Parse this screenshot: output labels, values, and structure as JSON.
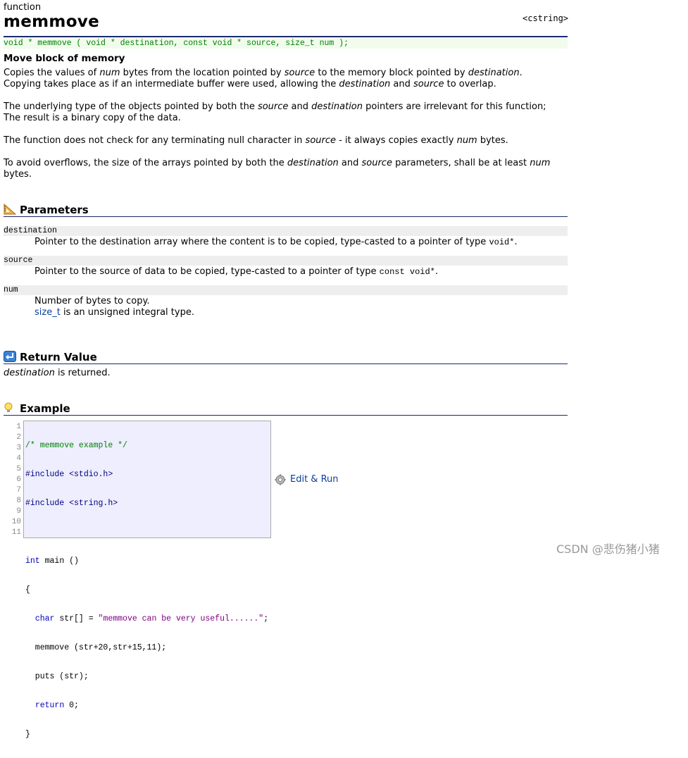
{
  "page": {
    "kind": "function",
    "title": "memmove",
    "header": "<cstring>",
    "prototype": "void * memmove ( void * destination, const void * source, size_t num );",
    "short_description": "Move block of memory"
  },
  "description": {
    "p1": {
      "a": "Copies the values of ",
      "b": "num",
      "c": " bytes from the location pointed by ",
      "d": "source",
      "e": " to the memory block pointed by ",
      "f": "destination",
      "g": ".",
      "h": "Copying takes place as if an intermediate buffer were used, allowing the ",
      "i": "destination",
      "j": " and ",
      "k": "source",
      "l": " to overlap."
    },
    "p2": {
      "a": "The underlying type of the objects pointed by both the ",
      "b": "source",
      "c": " and ",
      "d": "destination",
      "e": " pointers are irrelevant for this function;",
      "f": "The result is a binary copy of the data."
    },
    "p3": {
      "a": "The function does not check for any terminating null character in ",
      "b": "source",
      "c": " - it always copies exactly ",
      "d": "num",
      "e": " bytes."
    },
    "p4": {
      "a": "To avoid overflows, the size of the arrays pointed by both the ",
      "b": "destination",
      "c": " and ",
      "d": "source",
      "e": " parameters, shall be at least ",
      "f": "num",
      "g": "bytes."
    }
  },
  "parameters": {
    "heading": "Parameters",
    "icon": "ruler-triangle-icon",
    "items": [
      {
        "name": "destination",
        "desc_a": "Pointer to the destination array where the content is to be copied, type-casted to a pointer of type ",
        "desc_code": "void*",
        "desc_b": "."
      },
      {
        "name": "source",
        "desc_a": "Pointer to the source of data to be copied, type-casted to a pointer of type ",
        "desc_code": "const void*",
        "desc_b": "."
      },
      {
        "name": "num",
        "desc_a": "Number of bytes to copy.",
        "link": "size_t",
        "desc_b": " is an unsigned integral type."
      }
    ]
  },
  "return_value": {
    "heading": "Return Value",
    "icon": "return-arrow-icon",
    "var": "destination",
    "text": " is returned."
  },
  "example": {
    "heading": "Example",
    "icon": "lightbulb-icon",
    "line_numbers": [
      "1",
      "2",
      "3",
      "4",
      "5",
      "6",
      "7",
      "8",
      "9",
      "10",
      "11"
    ],
    "edit_run": "Edit & Run",
    "code": {
      "l1": "/* memmove example */",
      "l2": "#include <stdio.h>",
      "l3": "#include <string.h>",
      "l4": "",
      "l5_kw": "int",
      "l5_rest": " main ()",
      "l6": "{",
      "l7_kw": "char",
      "l7_mid": " str[] = ",
      "l7_str": "\"memmove can be very useful......\"",
      "l7_end": ";",
      "l8": "  memmove (str+20,str+15,11);",
      "l9": "  puts (str);",
      "l10_kw": "return",
      "l10_rest": " 0;",
      "l11": "}"
    }
  },
  "watermark": "CSDN @悲伤猪小猪",
  "colors": {
    "heading_rule": "#1a2a6c",
    "prototype_text": "#008000",
    "prototype_bg": "#f1fcec",
    "code_bg": "#eeeeff",
    "link": "#0b3e9c"
  }
}
